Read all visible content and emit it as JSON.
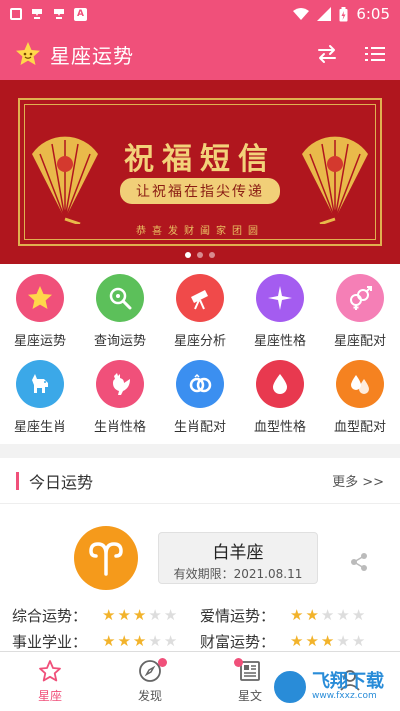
{
  "status_bar": {
    "time": "6:05",
    "left_icons": [
      "notification-box-icon",
      "app-notification-icon",
      "app-notification-icon",
      "a-notification-icon"
    ],
    "right_icons": [
      "wifi-icon",
      "signal-icon",
      "battery-icon"
    ]
  },
  "app_bar": {
    "title": "星座运势",
    "brand_color": "#f0507a",
    "actions": [
      "switch-icon",
      "menu-list-icon"
    ]
  },
  "banner": {
    "title": "祝福短信",
    "subtitle": "让祝福在指尖传递",
    "footer": "恭喜发财阖家团圆",
    "page_index": 1,
    "page_count": 3
  },
  "grid": {
    "items": [
      {
        "label": "星座运势",
        "icon": "star-icon",
        "color": "#f0507a"
      },
      {
        "label": "查询运势",
        "icon": "magnifier-icon",
        "color": "#5cc05a"
      },
      {
        "label": "星座分析",
        "icon": "telescope-icon",
        "color": "#f04a4a"
      },
      {
        "label": "星座性格",
        "icon": "sparkle-icon",
        "color": "#a45cf0"
      },
      {
        "label": "星座配对",
        "icon": "gender-pair-icon",
        "color": "#f57fb6"
      },
      {
        "label": "星座生肖",
        "icon": "dog-icon",
        "color": "#3ba8e8"
      },
      {
        "label": "生肖性格",
        "icon": "rooster-icon",
        "color": "#f0507a"
      },
      {
        "label": "生肖配对",
        "icon": "rings-icon",
        "color": "#3b8ff0"
      },
      {
        "label": "血型性格",
        "icon": "blood-drop-icon",
        "color": "#e8394f"
      },
      {
        "label": "血型配对",
        "icon": "double-drop-icon",
        "color": "#f58220"
      }
    ]
  },
  "today": {
    "title": "今日运势",
    "more": "更多 >>",
    "sign_name": "白羊座",
    "validity": "有效期限：2021.08.11",
    "sign_color": "#f59a1b",
    "ratings": [
      {
        "label": "综合运势：",
        "stars": 3,
        "max": 5
      },
      {
        "label": "爱情运势：",
        "stars": 2,
        "max": 5
      },
      {
        "label": "事业学业：",
        "stars": 3,
        "max": 5
      },
      {
        "label": "财富运势：",
        "stars": 3,
        "max": 5
      }
    ]
  },
  "bottom_nav": {
    "items": [
      {
        "label": "星座",
        "icon": "star-outline-icon",
        "active": true,
        "badge": false
      },
      {
        "label": "发现",
        "icon": "compass-icon",
        "active": false,
        "badge": true
      },
      {
        "label": "星文",
        "icon": "article-icon",
        "active": false,
        "badge": true
      },
      {
        "label": "",
        "icon": "profile-icon",
        "active": false,
        "badge": false
      }
    ]
  },
  "watermark": {
    "text": "飞翔下载",
    "url": "www.fxxz.com"
  }
}
